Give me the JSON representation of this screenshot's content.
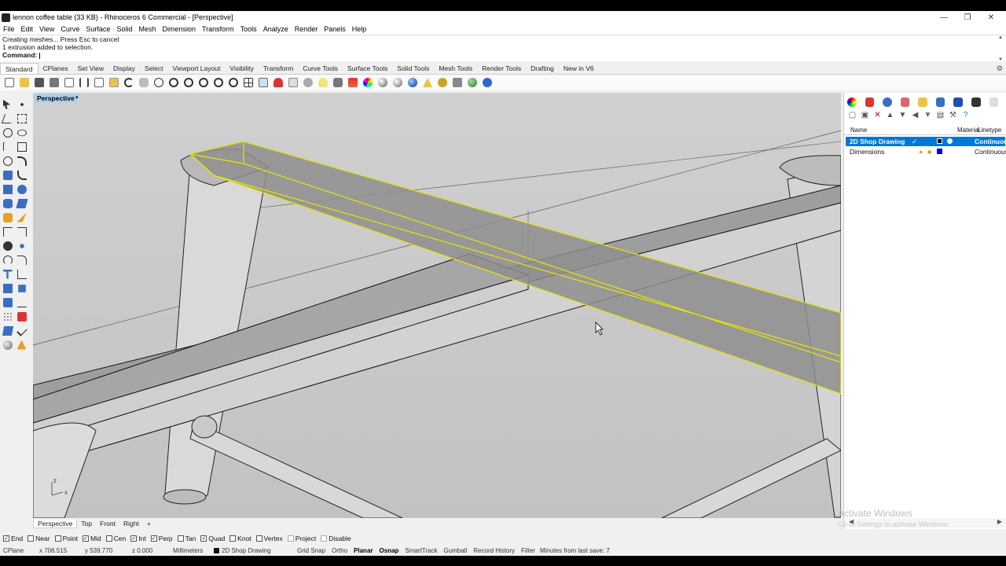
{
  "window": {
    "title": "lennon coffee table (33 KB) - Rhinoceros 6 Commercial - [Perspective]",
    "controls": {
      "minimize": "—",
      "restore": "❐",
      "close": "✕"
    }
  },
  "menu": [
    "File",
    "Edit",
    "View",
    "Curve",
    "Surface",
    "Solid",
    "Mesh",
    "Dimension",
    "Transform",
    "Tools",
    "Analyze",
    "Render",
    "Panels",
    "Help"
  ],
  "command": {
    "history": [
      "Creating meshes... Press Esc to cancel",
      "1 extrusion added to selection."
    ],
    "prompt": "Command:"
  },
  "toolbar_tabs": [
    "Standard",
    "CPlanes",
    "Set View",
    "Display",
    "Select",
    "Viewport Layout",
    "Visibility",
    "Transform",
    "Curve Tools",
    "Surface Tools",
    "Solid Tools",
    "Mesh Tools",
    "Render Tools",
    "Drafting",
    "New in V6"
  ],
  "active_toolbar_tab": "Standard",
  "toolbar_icons": [
    "new-icon",
    "open-icon",
    "save-icon",
    "print-icon",
    "import-icon",
    "cut-icon",
    "copy-icon",
    "paste-icon",
    "undo-icon",
    "pan-icon",
    "rotate-view-icon",
    "zoom-icon",
    "zoom-window-icon",
    "zoom-extents-icon",
    "zoom-selected-icon",
    "zoom-all-icon",
    "four-viewports-icon",
    "cplane-icon",
    "show-icon",
    "hide-icon",
    "point-icon",
    "light-icon",
    "lock-icon",
    "layer-icon",
    "render-icon",
    "material-icon",
    "environment-icon",
    "sphere-icon",
    "options-icon",
    "tools-icon",
    "explorer-icon",
    "help-icon"
  ],
  "viewport": {
    "label": "Perspective",
    "tabs": [
      "Perspective",
      "Top",
      "Front",
      "Right"
    ],
    "add_tab": "+",
    "axis": {
      "x": "x",
      "z": "z"
    },
    "watermark": "Activate Windows",
    "watermark_sub": "Go to Settings to activate Windows."
  },
  "osnaps": [
    {
      "label": "End",
      "checked": true
    },
    {
      "label": "Near",
      "checked": false
    },
    {
      "label": "Point",
      "checked": false
    },
    {
      "label": "Mid",
      "checked": true
    },
    {
      "label": "Cen",
      "checked": false
    },
    {
      "label": "Int",
      "checked": true
    },
    {
      "label": "Perp",
      "checked": true
    },
    {
      "label": "Tan",
      "checked": false
    },
    {
      "label": "Quad",
      "checked": true
    },
    {
      "label": "Knot",
      "checked": false
    },
    {
      "label": "Vertex",
      "checked": false
    },
    {
      "label": "Project",
      "checked": false
    },
    {
      "label": "Disable",
      "checked": false
    }
  ],
  "status": {
    "cplane": "CPlane",
    "x": "x 706.515",
    "y": "y 539.770",
    "z": "z 0.000",
    "units": "Millimeters",
    "layer": "2D Shop Drawing",
    "toggles": [
      "Grid Snap",
      "Ortho",
      "Planar",
      "Osnap",
      "SmartTrack",
      "Gumball",
      "Record History",
      "Filter"
    ],
    "active_toggles": [
      "Planar",
      "Osnap"
    ],
    "save_info": "Minutes from last save: 7"
  },
  "layers_panel": {
    "columns": [
      "Name",
      "Material",
      "Linetype"
    ],
    "rows": [
      {
        "name": "2D Shop Drawing",
        "selected": true,
        "color": "#000000",
        "linetype": "Continuous"
      },
      {
        "name": "Dimensions",
        "selected": false,
        "color": "#0000ff",
        "linetype": "Continuous"
      }
    ]
  },
  "colors": {
    "selection_highlight": "#ffff00",
    "viewport_bg": "#c8c8c8",
    "panel_selection": "#0078d7"
  }
}
